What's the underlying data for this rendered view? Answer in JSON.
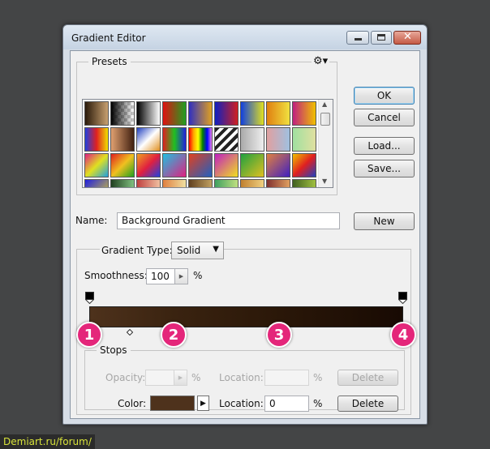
{
  "window": {
    "title": "Gradient Editor"
  },
  "presets": {
    "legend": "Presets",
    "menu_icon": "gear-icon",
    "swatches": [
      "linear-gradient(90deg,#2a1a0a,#c8a070)",
      "linear-gradient(90deg,#000,rgba(0,0,0,0))",
      "linear-gradient(90deg,#000,#fff)",
      "linear-gradient(90deg,#e01010,#20a020)",
      "linear-gradient(90deg,#3030c0,#e0a020)",
      "linear-gradient(90deg,#1020c0,#d02020)",
      "linear-gradient(90deg,#1040e0,#e0e020)",
      "linear-gradient(90deg,#e08010,#f0e040)",
      "linear-gradient(90deg,#c02080,#f0c000)",
      "linear-gradient(90deg,#2040e0,#e02020,#f0e000)",
      "linear-gradient(90deg,#e0a070,#402010)",
      "linear-gradient(135deg,#2040c0,#fff,#e09020)",
      "linear-gradient(90deg,#e02020,#20c020,#2020e0)",
      "linear-gradient(90deg,red,orange,yellow,green,blue,violet)",
      "repeating-linear-gradient(135deg,#222 0 4px,#fff 4px 8px)",
      "linear-gradient(90deg,#aaa,#eee)",
      "linear-gradient(90deg,#e0a0a0,#a0c0e0)",
      "linear-gradient(90deg,#a0e0a0,#e0e0a0)",
      "linear-gradient(135deg,#e02080,#e0e020,#20a0e0)",
      "linear-gradient(135deg,#e02020,#f0c020,#20a020)",
      "linear-gradient(135deg,#f0a020,#e02040,#2040e0)",
      "linear-gradient(135deg,#20c0e0,#e02080)",
      "linear-gradient(135deg,#e04020,#2060c0)",
      "linear-gradient(135deg,#c020c0,#f0e020)",
      "linear-gradient(135deg,#20a040,#e0c020)",
      "linear-gradient(135deg,#e08040,#4020c0)",
      "linear-gradient(135deg,#f0c000,#e02020,#2040c0)",
      "linear-gradient(135deg,#2020e0,#f0e020)",
      "linear-gradient(90deg,#204020,#80c080)",
      "linear-gradient(90deg,#c04040,#f0c0a0)",
      "linear-gradient(90deg,#e08040,#f0e0a0)",
      "linear-gradient(90deg,#604020,#c0a060)",
      "linear-gradient(90deg,#40a060,#c0e080)",
      "linear-gradient(90deg,#c08030,#f0d080)",
      "linear-gradient(90deg,#803030,#e0a060)",
      "linear-gradient(90deg,#406020,#a0c040)",
      "linear-gradient(90deg,#e07020,#f0b040)",
      "linear-gradient(90deg,#204080,#40a0c0)"
    ]
  },
  "buttons": {
    "ok": "OK",
    "cancel": "Cancel",
    "load": "Load...",
    "save": "Save...",
    "new": "New"
  },
  "name": {
    "label": "Name:",
    "value": "Background Gradient"
  },
  "gradient": {
    "type_label": "Gradient Type:",
    "type_value": "Solid",
    "smoothness_label": "Smoothness:",
    "smoothness_value": "100",
    "smoothness_unit": "%",
    "colors": [
      "#4e321c",
      "#3a2310",
      "#2a1708",
      "#180a03"
    ]
  },
  "stops": {
    "legend": "Stops",
    "opacity_label": "Opacity:",
    "opacity_value": "",
    "opacity_unit": "%",
    "opacity_location_label": "Location:",
    "opacity_location_value": "",
    "opacity_location_unit": "%",
    "opacity_delete": "Delete",
    "color_label": "Color:",
    "color_value": "#4e321c",
    "color_location_label": "Location:",
    "color_location_value": "0",
    "color_location_unit": "%",
    "color_delete": "Delete"
  },
  "badges": [
    "1",
    "2",
    "3",
    "4"
  ],
  "watermark": "Demiart.ru/forum/"
}
